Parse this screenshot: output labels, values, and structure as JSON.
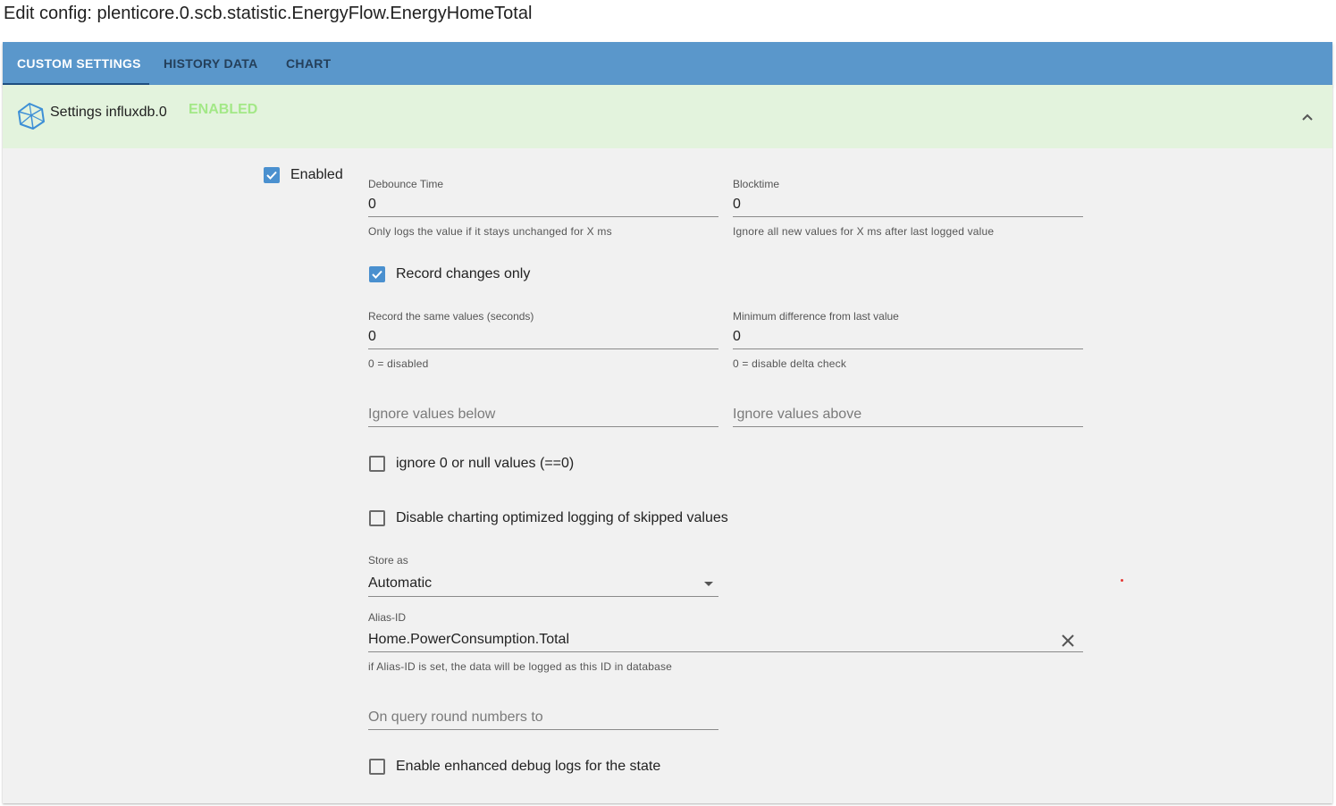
{
  "page_title": "Edit config: plenticore.0.scb.statistic.EnergyFlow.EnergyHomeTotal",
  "tabs": [
    {
      "label": "CUSTOM SETTINGS",
      "active": true
    },
    {
      "label": "HISTORY DATA",
      "active": false
    },
    {
      "label": "CHART",
      "active": false
    }
  ],
  "panel": {
    "title": "Settings influxdb.0",
    "status": "ENABLED",
    "icon": "influxdb-logo-icon",
    "collapse_icon": "chevron-up-icon"
  },
  "settings": {
    "enabled": {
      "label": "Enabled",
      "checked": true
    },
    "debounce_time": {
      "label": "Debounce Time",
      "value": "0",
      "helper": "Only logs the value if it stays unchanged for X ms"
    },
    "blocktime": {
      "label": "Blocktime",
      "value": "0",
      "helper": "Ignore all new values for X ms after last logged value"
    },
    "record_changes_only": {
      "label": "Record changes only",
      "checked": true
    },
    "record_same_values": {
      "label": "Record the same values (seconds)",
      "value": "0",
      "helper": "0 = disabled"
    },
    "min_difference": {
      "label": "Minimum difference from last value",
      "value": "0",
      "helper": "0 = disable delta check"
    },
    "ignore_below": {
      "placeholder": "Ignore values below",
      "value": ""
    },
    "ignore_above": {
      "placeholder": "Ignore values above",
      "value": ""
    },
    "ignore_zero": {
      "label": "ignore 0 or null values (==0)",
      "checked": false
    },
    "disable_charting": {
      "label": "Disable charting optimized logging of skipped values",
      "checked": false
    },
    "store_as": {
      "label": "Store as",
      "value": "Automatic"
    },
    "alias_id": {
      "label": "Alias-ID",
      "value": "Home.PowerConsumption.Total",
      "helper": "if Alias-ID is set, the data will be logged as this ID in database"
    },
    "round_numbers": {
      "placeholder": "On query round numbers to",
      "value": ""
    },
    "debug_logs": {
      "label": "Enable enhanced debug logs for the state",
      "checked": false
    }
  },
  "colors": {
    "tabbar": "#5a97cb",
    "panel_header": "#e3f3dd",
    "enabled_badge": "#a3e887",
    "checkbox_checked": "#4a90cf"
  }
}
